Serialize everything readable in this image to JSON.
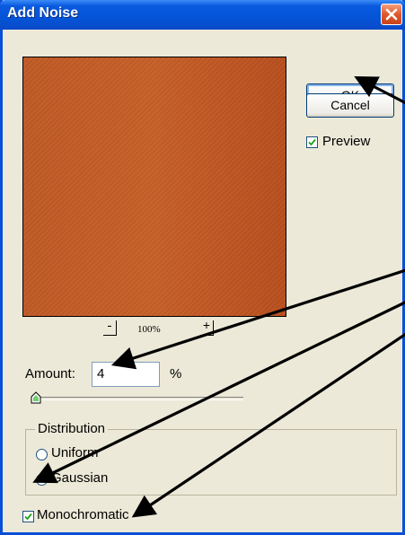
{
  "window": {
    "title": "Add Noise"
  },
  "buttons": {
    "ok_label": "OK",
    "cancel_label": "Cancel"
  },
  "preview_option": {
    "label": "Preview",
    "checked": true
  },
  "zoom": {
    "minus_label": "-",
    "level": "100%",
    "plus_label": "+"
  },
  "amount": {
    "label": "Amount:",
    "value": "4",
    "unit": "%"
  },
  "distribution": {
    "group_label": "Distribution",
    "options": [
      {
        "label": "Uniform",
        "selected": false
      },
      {
        "label": "Gaussian",
        "selected": true
      }
    ]
  },
  "monochromatic": {
    "label": "Monochromatic",
    "checked": true
  },
  "colors": {
    "preview_fill": "#c05a25",
    "title_bar": "#0554d8",
    "dialog_bg": "#ece9d8",
    "close_button": "#e0592c"
  }
}
